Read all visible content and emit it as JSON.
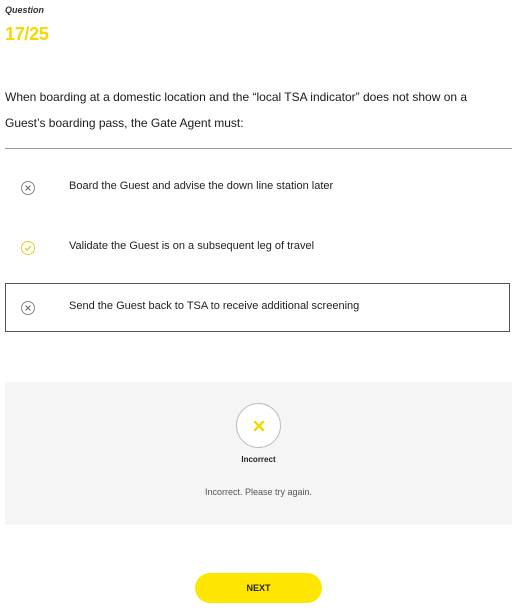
{
  "question": {
    "label": "Question",
    "counter": "17/25",
    "text": "When boarding at a domestic location and the “local TSA indicator” does not show on a Guest’s boarding pass, the Gate Agent must:"
  },
  "options": [
    {
      "label": "Board the Guest and advise the down line station later",
      "state": "incorrect",
      "icon": "x-circle-icon"
    },
    {
      "label": "Validate the Guest is on a subsequent leg of travel",
      "state": "correct",
      "icon": "check-circle-icon"
    },
    {
      "label": "Send the Guest back to TSA to receive additional screening",
      "state": "incorrect-selected",
      "icon": "x-circle-icon"
    }
  ],
  "feedback": {
    "icon": "x-icon",
    "title": "Incorrect",
    "message": "Incorrect. Please try again."
  },
  "next_button": {
    "label": "NEXT"
  },
  "colors": {
    "accent_yellow": "#ffe600",
    "counter_yellow": "#f5d800",
    "feedback_bg": "#f5f5f5",
    "divider": "#9a9a9a"
  }
}
